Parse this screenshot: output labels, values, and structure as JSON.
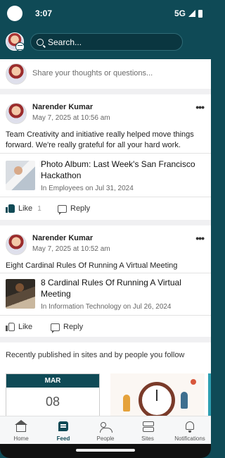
{
  "status_bar": {
    "time": "3:07",
    "network": "5G"
  },
  "header": {
    "search_placeholder": "Search..."
  },
  "composer": {
    "placeholder": "Share your thoughts or questions..."
  },
  "posts": [
    {
      "author": "Narender Kumar",
      "date": "May 7, 2025 at 10:56 am",
      "body": "Team Creativity and initiative really helped move things forward. We're really grateful for all your hard work.",
      "link_title": "Photo Album: Last Week's San Francisco Hackathon",
      "link_meta": "In Employees on Jul 31, 2024",
      "like_label": "Like",
      "like_count": "1",
      "reply_label": "Reply",
      "liked": true
    },
    {
      "author": "Narender Kumar",
      "date": "May 7, 2025 at 10:52 am",
      "body": "Eight Cardinal Rules Of Running A Virtual Meeting",
      "link_title": "8 Cardinal Rules Of Running A Virtual Meeting",
      "link_meta": "In Information Technology on Jul 26, 2024",
      "like_label": "Like",
      "reply_label": "Reply",
      "liked": false
    }
  ],
  "recent": {
    "heading": "Recently published in sites and by people you follow",
    "calendar_month": "MAR",
    "calendar_day": "08"
  },
  "nav": [
    {
      "label": "Home",
      "icon": "home-icon"
    },
    {
      "label": "Feed",
      "icon": "feed-icon",
      "active": true
    },
    {
      "label": "People",
      "icon": "people-icon"
    },
    {
      "label": "Sites",
      "icon": "sites-icon"
    },
    {
      "label": "Notifications",
      "icon": "bell-icon"
    }
  ],
  "colors": {
    "brand": "#0f4a56",
    "accent": "#2e9fb2"
  }
}
